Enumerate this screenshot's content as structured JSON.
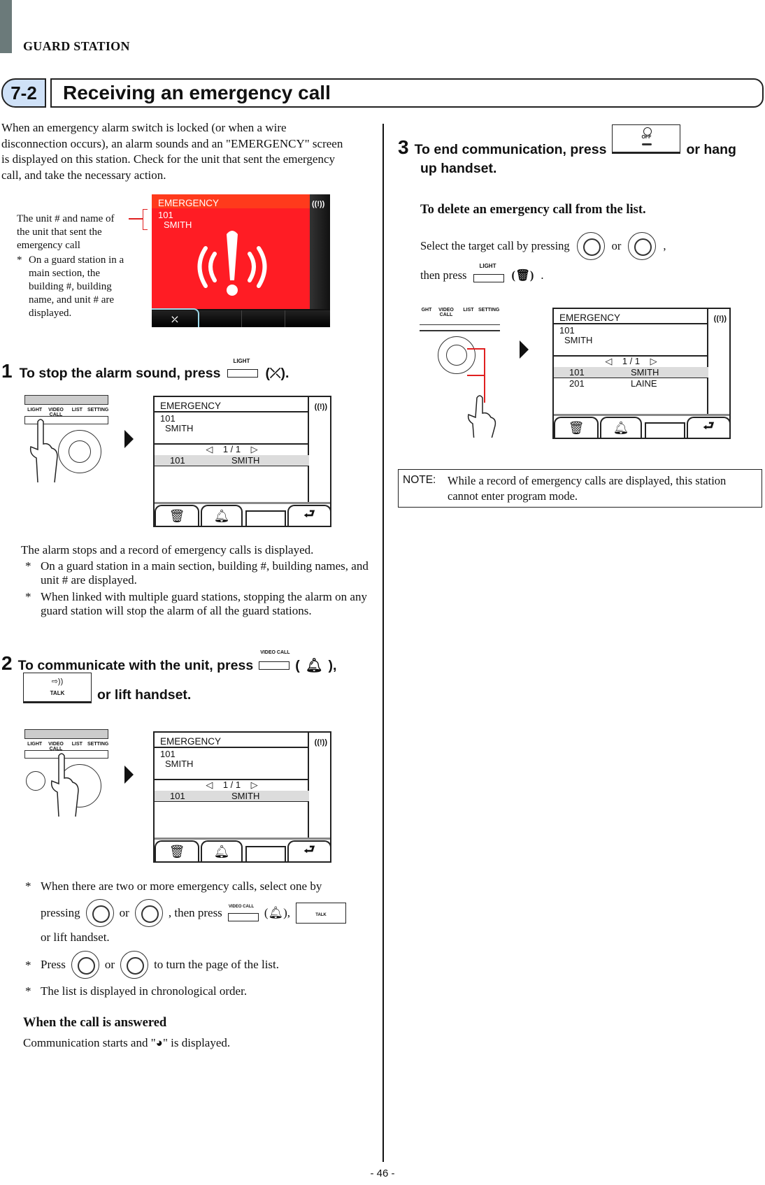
{
  "header": {
    "section": "GUARD STATION",
    "section_number": "7-2",
    "title": "Receiving an emergency call"
  },
  "intro": "When an emergency alarm switch is locked (or when a wire disconnection occurs), an alarm sounds and an \"EMERGENCY\" screen is displayed on this station. Check for the unit that sent the emergency call, and take the necessary action.",
  "callout": {
    "label": "The unit # and name of the unit that sent the emergency call",
    "note": "On a guard station in a main section, the building #, building name, and unit # are displayed."
  },
  "red_screen": {
    "header": "EMERGENCY",
    "unit_number": "101",
    "unit_name": "SMITH",
    "background_color": "#ff1c24",
    "icons": [
      "alarm-indicator-icon",
      "emergency-alarm-icon",
      "alarm-mute-icon"
    ]
  },
  "device_labels": [
    "LIGHT",
    "VIDEO CALL",
    "LIST",
    "SETTING"
  ],
  "steps": [
    {
      "number": "1",
      "text_before": "To stop the alarm sound, press",
      "key_label": "LIGHT",
      "text_after": "(⤫).",
      "icon": "alarm-mute-icon",
      "screen": {
        "header": "EMERGENCY",
        "unit_number": "101",
        "unit_name": "SMITH",
        "pager": "1 / 1",
        "rows": [
          {
            "unit": "101",
            "name": "SMITH",
            "selected": true
          }
        ]
      },
      "result": "The alarm stops and a record of emergency calls is displayed.",
      "notes": [
        "On a guard station in a main section, building #, building names, and unit # are displayed.",
        "When linked with multiple guard stations, stopping the alarm on any guard station will stop the alarm of all the guard stations."
      ]
    },
    {
      "number": "2",
      "text_before": "To communicate with the unit, press",
      "key_label": "VIDEO CALL",
      "text_mid": "(",
      "text_after": "),",
      "talk_label": "TALK",
      "text_line2": "or lift handset.",
      "screen": {
        "header": "EMERGENCY",
        "unit_number": "101",
        "unit_name": "SMITH",
        "pager": "1 / 1",
        "rows": [
          {
            "unit": "101",
            "name": "SMITH",
            "selected": true
          }
        ]
      },
      "notes": {
        "n1_a": "When there are two or more emergency calls, select one by",
        "n1_b_pressing": "pressing",
        "n1_b_or": "or",
        "n1_b_then": ", then press",
        "n1_b_paren_open": "(",
        "n1_b_paren_close": "),",
        "n1_c": "or lift handset.",
        "n2_press": "Press",
        "n2_or": "or",
        "n2_rest": "to turn the page of the list.",
        "n3": "The list is displayed in chronological order."
      },
      "answered_heading": "When the call is answered",
      "answered_before": "Communication starts and \"",
      "answered_after": "\" is displayed."
    },
    {
      "number": "3",
      "text_before": "To end communication, press",
      "key_label": "OFF",
      "text_after": "or hang",
      "text_line2": "up handset."
    }
  ],
  "delete": {
    "heading": "To delete an emergency call from the list.",
    "line1_before": "Select the target call by pressing",
    "line1_or": "or",
    "line1_after": ",",
    "line2_before": "then press",
    "key_label": "LIGHT",
    "line2_after": ".",
    "screen": {
      "header": "EMERGENCY",
      "unit_number": "101",
      "unit_name": "SMITH",
      "pager": "1 / 1",
      "rows": [
        {
          "unit": "101",
          "name": "SMITH",
          "selected": true
        },
        {
          "unit": "201",
          "name": "LAINE",
          "selected": false
        }
      ]
    }
  },
  "note": {
    "label": "NOTE:",
    "text": "While a record of emergency calls are displayed, this station cannot enter program mode."
  },
  "page_number": "- 46 -"
}
